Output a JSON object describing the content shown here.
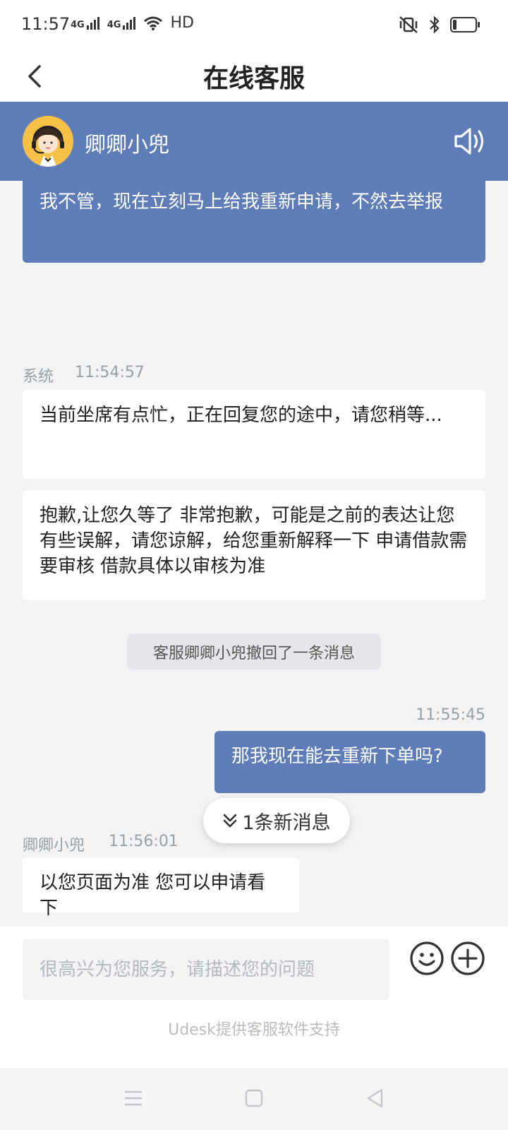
{
  "status": {
    "time": "11:57",
    "signal1": "4G",
    "signal2": "4G",
    "hd": "HD"
  },
  "header": {
    "title": "在线客服"
  },
  "agent": {
    "name": "卿卿小兜"
  },
  "messages": {
    "m1": "我不管，现在立刻马上给我重新申请，不然去举报",
    "system_sender": "系统",
    "system_time": "11:54:57",
    "m2": "当前坐席有点忙，正在回复您的途中，请您稍等...",
    "m3": "抱歉,让您久等了 非常抱歉，可能是之前的表达让您有些误解，请您谅解，给您重新解释一下 申请借款需要审核 借款具体以审核为准",
    "recall_notice": "客服卿卿小兜撤回了一条消息",
    "user_time": "11:55:45",
    "m4": "那我现在能去重新下单吗?",
    "agent_sender": "卿卿小兜",
    "agent_time": "11:56:01",
    "m5": "以您页面为准 您可以申请看下"
  },
  "new_messages_pill": "1条新消息",
  "input": {
    "placeholder": "很高兴为您服务，请描述您的问题"
  },
  "powered_by": "Udesk提供客服软件支持",
  "colors": {
    "accent": "#5e7cb8",
    "background": "#f2f3f5"
  },
  "battery_level": 0.15
}
